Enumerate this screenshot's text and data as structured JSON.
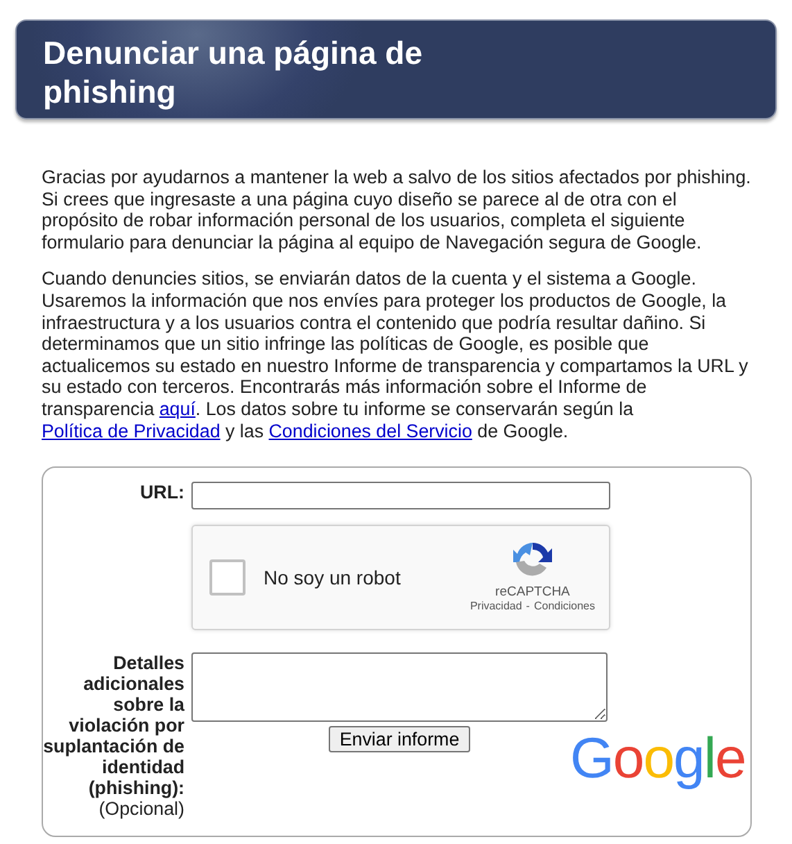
{
  "header": {
    "title": "Denunciar una página de phishing"
  },
  "paragraphs": [
    [
      {
        "kind": "text",
        "text": "Gracias por ayudarnos a mantener la web a salvo de los sitios afectados por phishing. Si crees que ingresaste a una página cuyo diseño se parece al de otra con el propósito de robar información personal de los usuarios, completa el siguiente formulario para denunciar la página al equipo de Navegación segura de Google."
      }
    ],
    [
      {
        "kind": "text",
        "text": "Cuando denuncies sitios, se enviarán datos de la cuenta y el sistema a Google. Usaremos la información que nos envíes para proteger los productos de Google, la infraestructura y a los usuarios contra el contenido que podría resultar dañino. Si determinamos que un sitio infringe las políticas de Google, es posible que actualicemos su estado en nuestro Informe de transparencia y compartamos la URL y su estado con terceros. Encontrarás más información sobre el Informe de transparencia "
      },
      {
        "kind": "link",
        "text": "aquí"
      },
      {
        "kind": "text",
        "text": ". Los datos sobre tu informe se conservarán según la "
      },
      {
        "kind": "link",
        "text": "Política de Privacidad"
      },
      {
        "kind": "text",
        "text": " y las "
      },
      {
        "kind": "link",
        "text": "Condiciones del Servicio"
      },
      {
        "kind": "text",
        "text": " de Google."
      }
    ]
  ],
  "form": {
    "url_label": "URL:",
    "captcha": {
      "label": "No soy un robot",
      "checked": false,
      "brand": "reCAPTCHA",
      "privacy": "Privacidad",
      "separator": "-",
      "terms": "Condiciones"
    },
    "details_label": "Detalles adicionales sobre la violación por suplantación de identidad (phishing):",
    "details_note": "(Opcional)",
    "submit": "Enviar informe",
    "logo": "Google"
  }
}
